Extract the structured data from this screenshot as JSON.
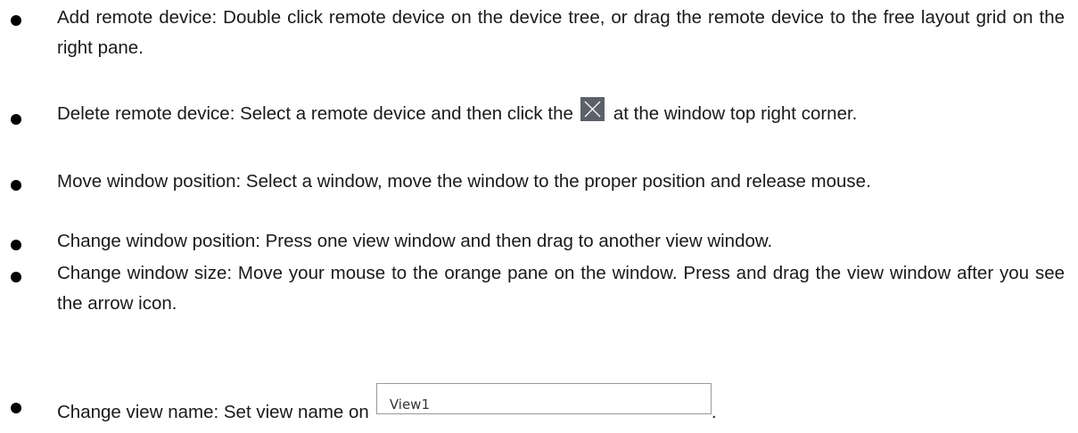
{
  "items": [
    {
      "text": "Add remote device: Double click remote device on the device tree, or drag the remote device to the free layout grid on the right pane."
    },
    {
      "before": "Delete remote device: Select a remote device and then click the",
      "icon": "close-icon",
      "after": "at the window top right corner."
    },
    {
      "text": "Move window position: Select a window, move the window to the proper position and release mouse."
    },
    {
      "text": "Change window position: Press one view window and then drag to another view window."
    },
    {
      "text": "Change window size: Move your mouse to the orange pane on the window. Press and drag the view window after you see the arrow icon."
    },
    {
      "before": "Change view name: Set view name on",
      "field_value": "View1",
      "after": "."
    }
  ],
  "colors": {
    "icon_bg": "#5c6069",
    "field_border": "#9a9a9a"
  }
}
